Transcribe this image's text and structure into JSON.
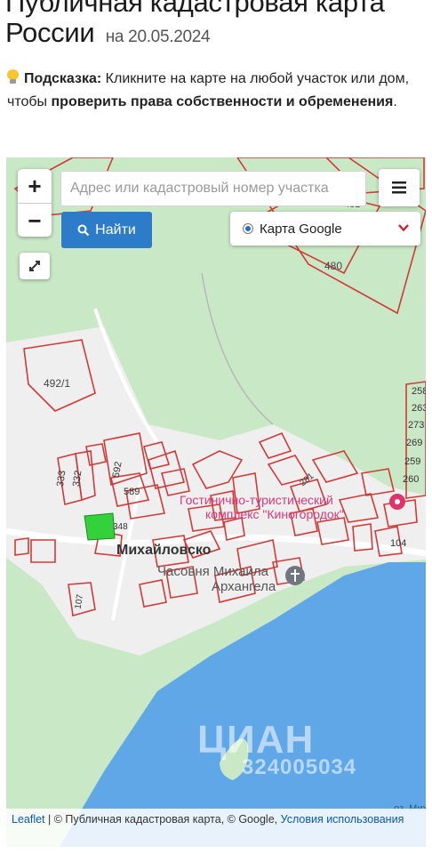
{
  "header": {
    "title": "Публичная кадастровая карта России",
    "date_prefix": "на",
    "date": "20.05.2024"
  },
  "hint": {
    "label": "Подсказка:",
    "text_1": "Кликните на карте на любой участок или дом, чтобы",
    "emphasis": "проверить права собственности и обременения",
    "end": "."
  },
  "controls": {
    "zoom_in": "+",
    "zoom_out": "−",
    "search_placeholder": "Адрес или кадастровый номер участка",
    "find_label": "Найти",
    "layer_label": "Карта Google"
  },
  "map": {
    "parcel_labels": [
      "481",
      "480",
      "492/1",
      "592",
      "589",
      "333",
      "332",
      "348",
      "281",
      "258",
      "263",
      "273",
      "269",
      "259",
      "260",
      "104",
      "107"
    ],
    "places": {
      "village": "Михайловско",
      "hotel_line1": "Гостинично-туристический",
      "hotel_line2": "комплекс \"Киногородок\"",
      "chapel_line1": "Часовня Михаила",
      "chapel_line2": "Архангела",
      "lake": "оз. Михай"
    },
    "watermark_brand": "ЦИАН",
    "watermark_id": "324005034",
    "colors": {
      "land": "#c9e8c6",
      "water": "#5fa7e6",
      "parcel": "#d23a3a",
      "settlement": "#f1f1f1",
      "selected": "#33d13a"
    }
  },
  "attribution": {
    "leaflet": "Leaflet",
    "sep1": " | © ",
    "pkk": "Публичная кадастровая карта",
    "sep2": ", © Google, ",
    "terms": "Условия использования"
  }
}
